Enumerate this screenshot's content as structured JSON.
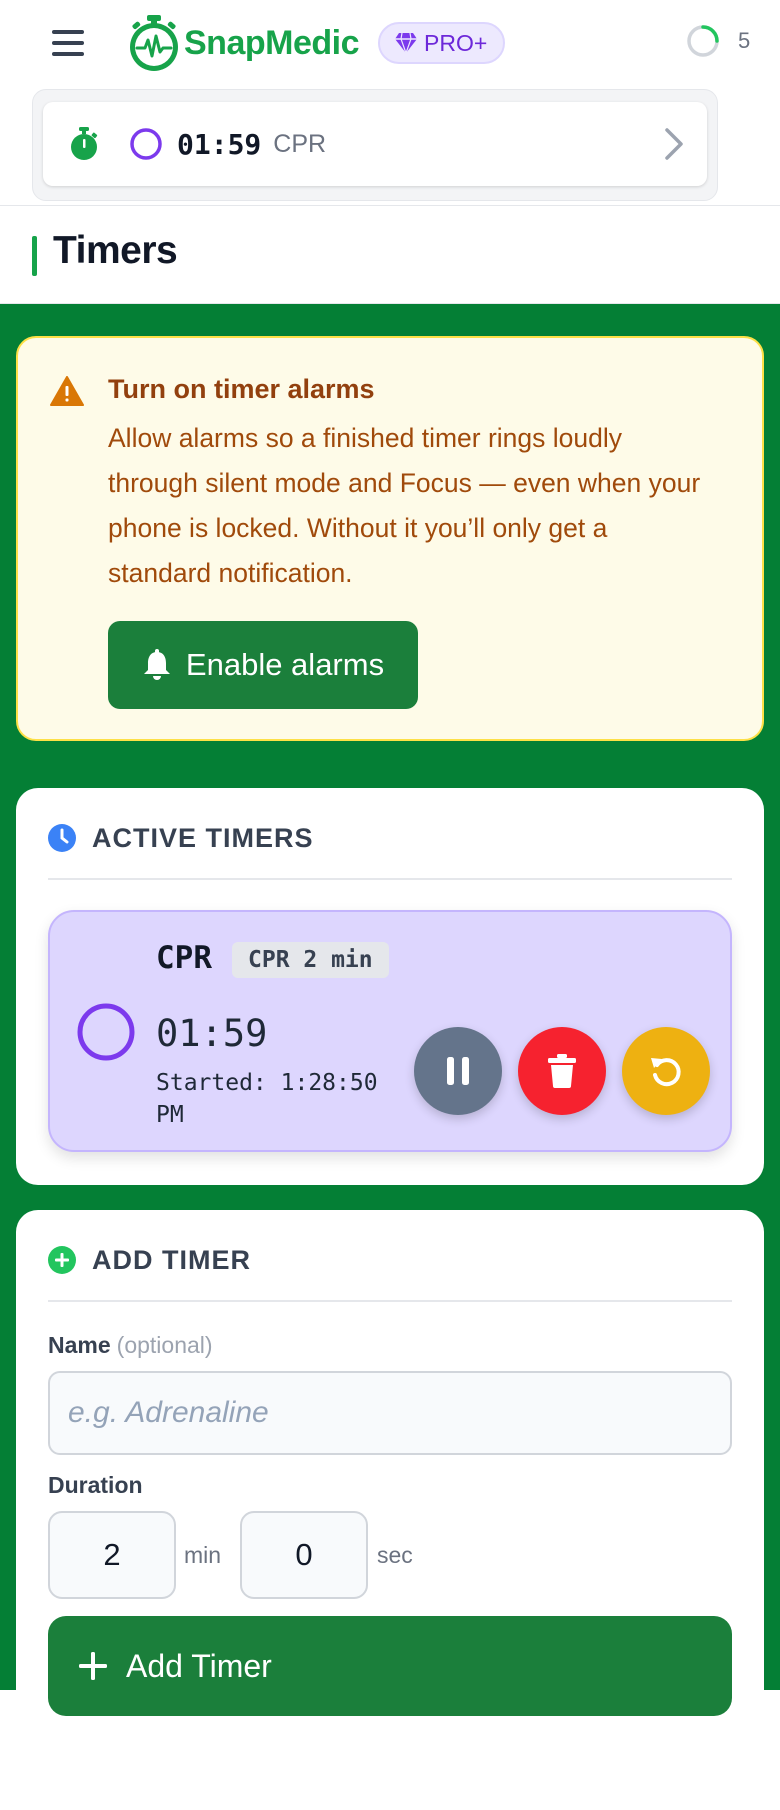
{
  "header": {
    "app_name": "SnapMedic",
    "badge": "PRO+",
    "sync_count": "5",
    "active_timer": {
      "time": "01:59",
      "label": "CPR"
    }
  },
  "page": {
    "title": "Timers"
  },
  "alert": {
    "title": "Turn on timer alarms",
    "body": "Allow alarms so a finished timer rings loudly through silent mode and Focus — even when your phone is locked. Without it you’ll only get a standard notification.",
    "button": "Enable alarms"
  },
  "active_timers": {
    "heading": "ACTIVE TIMERS",
    "timers": [
      {
        "name": "CPR",
        "tag": "CPR 2 min",
        "time": "01:59",
        "started": "Started: 1:28:50 PM"
      }
    ]
  },
  "add_timer": {
    "heading": "ADD TIMER",
    "name_label": "Name",
    "name_optional": "(optional)",
    "name_placeholder": "e.g. Adrenaline",
    "duration_label": "Duration",
    "minutes": "2",
    "min_unit": "min",
    "seconds": "0",
    "sec_unit": "sec",
    "button": "Add Timer"
  },
  "colors": {
    "brand_green": "#17a34a",
    "main_bg": "#047f35",
    "alert_bg": "#fefbe8",
    "timer_card_bg": "#ddd6fe",
    "delete": "#f6222f",
    "reset": "#eeb111",
    "pause": "#64748b"
  }
}
